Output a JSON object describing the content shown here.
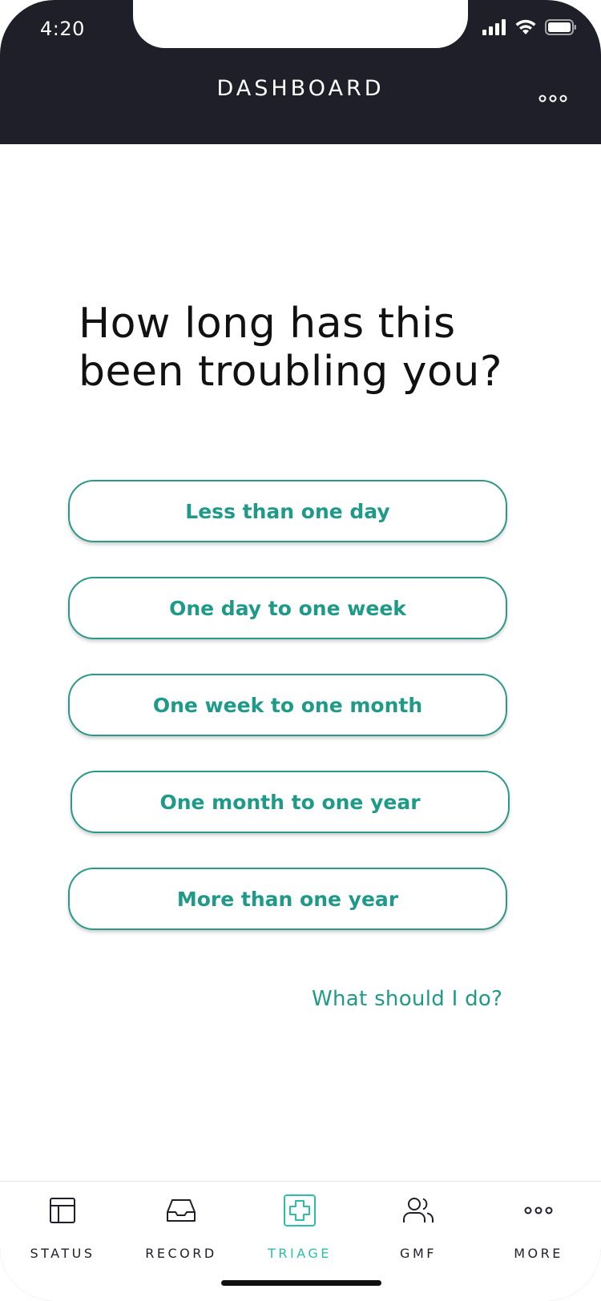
{
  "status_bar": {
    "time": "4:20",
    "signal_icon": "signal-bars-icon",
    "wifi_icon": "wifi-icon",
    "battery_icon": "battery-icon"
  },
  "header": {
    "title": "DASHBOARD",
    "menu_icon": "more-horizontal-icon"
  },
  "question": {
    "text": "How long has this been troubling you?"
  },
  "options": [
    {
      "label": "Less than one day"
    },
    {
      "label": "One day to one week"
    },
    {
      "label": "One week to one month"
    },
    {
      "label": "One month to one year"
    },
    {
      "label": "More than one year"
    }
  ],
  "help_link": {
    "label": "What should I do?"
  },
  "tabbar": {
    "items": [
      {
        "label": "STATUS",
        "icon": "layout-icon",
        "active": false
      },
      {
        "label": "RECORD",
        "icon": "inbox-icon",
        "active": false
      },
      {
        "label": "TRIAGE",
        "icon": "medical-cross-icon",
        "active": true
      },
      {
        "label": "GMF",
        "icon": "users-icon",
        "active": false
      },
      {
        "label": "MORE",
        "icon": "more-horizontal-icon",
        "active": false
      }
    ]
  },
  "colors": {
    "header_bg": "#1e1f29",
    "accent": "#1f9a88",
    "active_tab": "#2bbfa8"
  }
}
